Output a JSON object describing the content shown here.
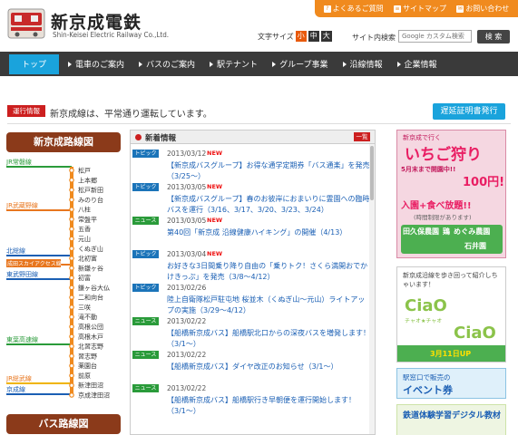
{
  "header": {
    "title": "新京成電鉄",
    "subtitle": "Shin-Keisei Electric Railway Co.,Ltd.",
    "top_links": [
      "よくあるご質問",
      "サイトマップ",
      "お問い合わせ"
    ],
    "font_size_label": "文字サイズ",
    "font_sizes": [
      "小",
      "中",
      "大"
    ],
    "search_label": "サイト内検索",
    "search_placeholder": "Google カスタム検索",
    "search_button": "検 索"
  },
  "nav": {
    "items": [
      "トップ",
      "電車のご案内",
      "バスのご案内",
      "駅テナント",
      "グループ事業",
      "沿線情報",
      "企業情報"
    ],
    "active_index": 0
  },
  "status": {
    "badge": "運行情報",
    "text": "新京成線は、平常通り運転しています。",
    "delay_button": "遅延証明書発行"
  },
  "route_map": {
    "title": "新京成路線図",
    "lines": [
      "JR常磐線",
      "JR武蔵野線",
      "北総線",
      "成田スカイアクセス線",
      "東武野田線",
      "東葉高速線",
      "JR総武線",
      "京成線"
    ],
    "stations": [
      "松戸",
      "上本郷",
      "松戸新田",
      "みのり台",
      "八柱",
      "常盤平",
      "五香",
      "元山",
      "くぬぎ山",
      "北初富",
      "新鎌ヶ谷",
      "初富",
      "鎌ヶ谷大仏",
      "二和向台",
      "三咲",
      "滝不動",
      "高根公団",
      "高根木戸",
      "北習志野",
      "習志野",
      "薬園台",
      "前原",
      "新津田沼",
      "京成津田沼"
    ],
    "line_color": "#f08a1e"
  },
  "bus_map": {
    "title": "バス路線図"
  },
  "news": {
    "title": "新着情報",
    "list_button": "一覧",
    "items": [
      {
        "tag": "トピックス",
        "type": "topics",
        "date": "2013/03/12",
        "new": "NEW",
        "text": "【新京成バスグループ】お得な通学定期券「バス通楽」を発売（3/25～）"
      },
      {
        "tag": "トピックス",
        "type": "topics",
        "date": "2013/03/05",
        "new": "NEW",
        "text": "【新京成バスグループ】春のお彼岸におまいりに霊園への臨時バスを運行（3/16、3/17、3/20、3/23、3/24）"
      },
      {
        "tag": "ニュース",
        "type": "news",
        "date": "2013/03/05",
        "new": "NEW",
        "text": "第40回「新京成 沿線健康ハイキング」の開催（4/13）"
      },
      {
        "tag": "トピックス",
        "type": "topics",
        "date": "2013/03/04",
        "new": "NEW",
        "text": "お好きな3日間乗り降り自由の「乗りトク！さくら満開おでかけきっぷ」を発売（3/8～4/12）"
      },
      {
        "tag": "トピックス",
        "type": "topics",
        "date": "2013/02/26",
        "new": "",
        "text": "陸上自衛隊松戸駐屯地 桜並木（くぬぎ山～元山）ライトアップの実施（3/29～4/12）"
      },
      {
        "tag": "ニュース",
        "type": "news",
        "date": "2013/02/22",
        "new": "",
        "text": "【船橋新京成バス】船橋駅北口からの深夜バスを増発します！（3/1～）"
      },
      {
        "tag": "ニュース",
        "type": "news",
        "date": "2013/02/22",
        "new": "",
        "text": "【船橋新京成バス】ダイヤ改正のお知らせ（3/1～）"
      },
      {
        "tag": "ニュース",
        "type": "news",
        "date": "2013/02/22",
        "new": "",
        "text": "【船橋新京成バス】船橋駅行き早朝便を運行開始します！（3/1～）"
      }
    ]
  },
  "banners": {
    "b1_title": "いちご狩り",
    "b1_top": "新京成で行く",
    "b1_period": "5月末まで開園中!!",
    "b1_price": "100円!",
    "b1_main": "入園+食べ放題!!",
    "b1_note": "(時間制限があります)",
    "b1_farms": [
      "田久保農園",
      "鶏",
      "めぐみ農園",
      "石井園"
    ],
    "b2_text": "新京成沿線を歩き回って紹介しちゃいます！",
    "b2_logo1": "CiaO",
    "b2_logo1_sub": "チャオ★チャオ",
    "b2_logo2": "CiaO",
    "b2_date": "3月11日UP",
    "b3_text1": "駅窓口で販売の",
    "b3_text2": "イベント券",
    "b4_text": "鉄道体験学習デジタル教材"
  }
}
